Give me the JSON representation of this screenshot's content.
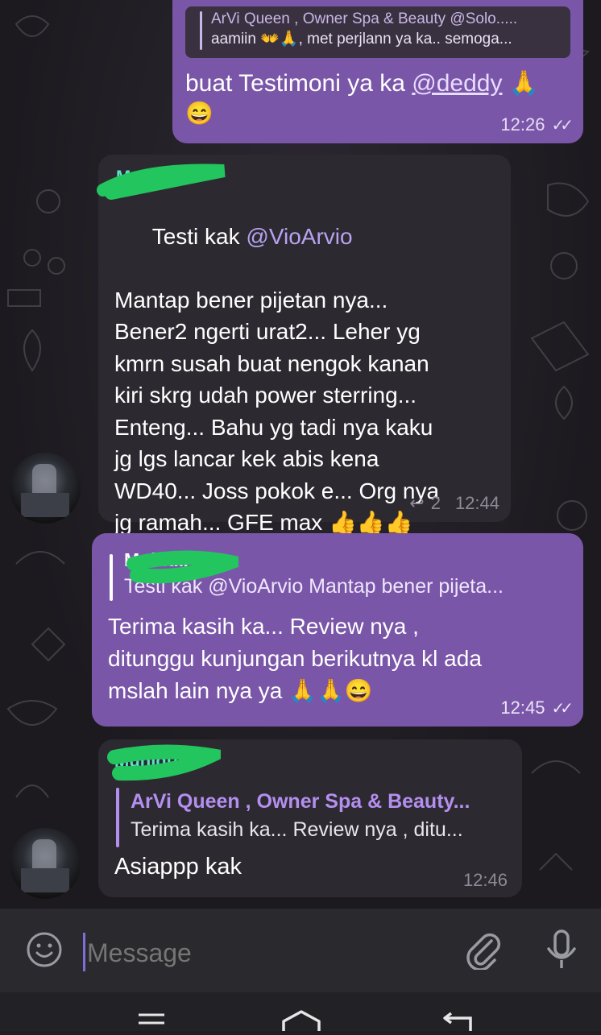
{
  "messages": [
    {
      "id": "m1",
      "direction": "outgoing",
      "reply_to": {
        "author": "ArVi Queen , Owner Spa & Beauty @Solo.....",
        "text": "aamiin 👐🙏, met perjlann ya ka.. semoga..."
      },
      "text_before_mention": "buat Testimoni ya ka ",
      "mention": "@deddy",
      "text_after_mention": " 🙏",
      "emoji_line": "😄",
      "time": "12:26"
    },
    {
      "id": "m2",
      "direction": "incoming",
      "sender": "MuhidiAP",
      "line1_prefix": "Testi kak ",
      "line1_mention": "@VioArvio",
      "body": "Mantap bener pijetan nya...\nBener2 ngerti urat2... Leher yg\nkmrn susah buat nengok kanan\nkiri skrg udah power sterring...\nEnteng... Bahu yg tadi nya kaku\njg lgs lancar kek abis kena\nWD40... Joss pokok e... Org nya\njg ramah... GFE max 👍👍👍",
      "reply_count": "2",
      "time": "12:44"
    },
    {
      "id": "m3",
      "direction": "outgoing",
      "reply_to": {
        "author": "MuhidiAP",
        "text": "Testi kak @VioArvio  Mantap bener pijeta..."
      },
      "body": "Terima kasih ka... Review nya ,\nditunggu kunjungan berikutnya kl ada\nmslah lain nya ya 🙏🙏😄",
      "time": "12:45"
    },
    {
      "id": "m4",
      "direction": "incoming",
      "sender": "MuhidiAP",
      "reply_to": {
        "author": "ArVi Queen , Owner Spa & Beauty...",
        "text": "Terima kasih ka... Review nya , ditu..."
      },
      "body": "Asiappp kak",
      "time": "12:46"
    }
  ],
  "composer": {
    "placeholder": "Message"
  },
  "colors": {
    "outgoing_bubble": "#7a56a8",
    "incoming_bubble": "#2c2a30",
    "sender_name": "#5ee0c8",
    "reply_author_out": "#ffffff",
    "reply_author_in": "#b58ff0",
    "redaction_green": "#22c55e"
  },
  "icons": {
    "emoji": "emoji-icon",
    "attach": "paperclip-icon",
    "mic": "microphone-icon",
    "read": "double-check-icon",
    "reply": "reply-icon",
    "nav_menu": "menu-icon",
    "nav_home": "home-icon",
    "nav_back": "back-icon"
  }
}
